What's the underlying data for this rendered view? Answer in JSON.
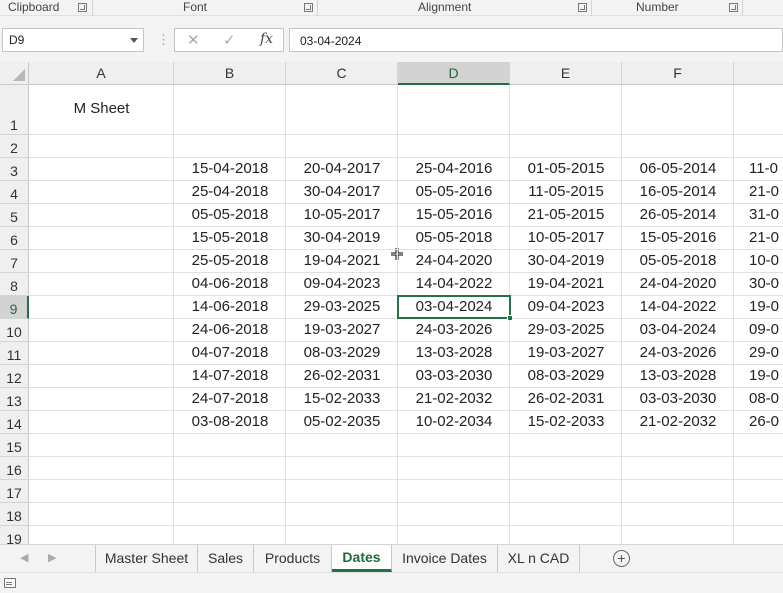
{
  "ribbon": {
    "groups": [
      "Clipboard",
      "Font",
      "Alignment",
      "Number"
    ]
  },
  "formula_bar": {
    "name_box": "D9",
    "cancel_glyph": "✕",
    "enter_glyph": "✓",
    "fx_label": "fx",
    "formula": "03-04-2024"
  },
  "sheet": {
    "columns": [
      "A",
      "B",
      "C",
      "D",
      "E",
      "F"
    ],
    "rows": [
      "1",
      "2",
      "3",
      "4",
      "5",
      "6",
      "7",
      "8",
      "9",
      "10",
      "11",
      "12",
      "13",
      "14",
      "15",
      "16",
      "17",
      "18",
      "19"
    ],
    "title_cell": "M Sheet",
    "selected_cell": "D9",
    "data": [
      [
        "15-04-2018",
        "20-04-2017",
        "25-04-2016",
        "01-05-2015",
        "06-05-2014",
        "11-0"
      ],
      [
        "25-04-2018",
        "30-04-2017",
        "05-05-2016",
        "11-05-2015",
        "16-05-2014",
        "21-0"
      ],
      [
        "05-05-2018",
        "10-05-2017",
        "15-05-2016",
        "21-05-2015",
        "26-05-2014",
        "31-0"
      ],
      [
        "15-05-2018",
        "30-04-2019",
        "05-05-2018",
        "10-05-2017",
        "15-05-2016",
        "21-0"
      ],
      [
        "25-05-2018",
        "19-04-2021",
        "24-04-2020",
        "30-04-2019",
        "05-05-2018",
        "10-0"
      ],
      [
        "04-06-2018",
        "09-04-2023",
        "14-04-2022",
        "19-04-2021",
        "24-04-2020",
        "30-0"
      ],
      [
        "14-06-2018",
        "29-03-2025",
        "03-04-2024",
        "09-04-2023",
        "14-04-2022",
        "19-0"
      ],
      [
        "24-06-2018",
        "19-03-2027",
        "24-03-2026",
        "29-03-2025",
        "03-04-2024",
        "09-0"
      ],
      [
        "04-07-2018",
        "08-03-2029",
        "13-03-2028",
        "19-03-2027",
        "24-03-2026",
        "29-0"
      ],
      [
        "14-07-2018",
        "26-02-2031",
        "03-03-2030",
        "08-03-2029",
        "13-03-2028",
        "19-0"
      ],
      [
        "24-07-2018",
        "15-02-2033",
        "21-02-2032",
        "26-02-2031",
        "03-03-2030",
        "08-0"
      ],
      [
        "03-08-2018",
        "05-02-2035",
        "10-02-2034",
        "15-02-2033",
        "21-02-2032",
        "26-0"
      ]
    ]
  },
  "tabs": {
    "items": [
      "Master Sheet",
      "Sales",
      "Products",
      "Dates",
      "Invoice Dates",
      "XL n CAD"
    ],
    "active": "Dates",
    "add_glyph": "+"
  },
  "colors": {
    "accent": "#217346",
    "header_bg": "#efefef",
    "gridline": "#e1e1e1"
  },
  "icons": [
    "dialog-launcher-icon",
    "name-box-dropdown-icon",
    "cancel-icon",
    "enter-icon",
    "insert-function-icon",
    "sheet-nav-prev-icon",
    "sheet-nav-next-icon",
    "add-sheet-icon",
    "macro-record-icon",
    "move-cursor-icon"
  ]
}
